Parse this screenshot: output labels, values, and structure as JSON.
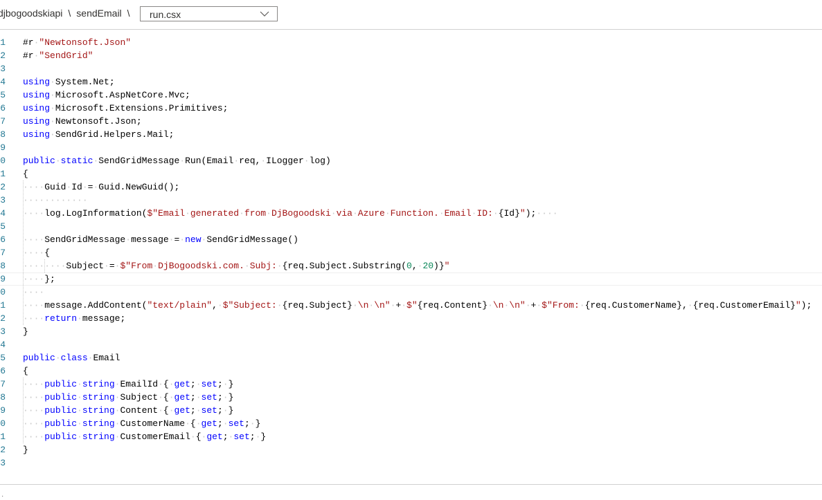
{
  "breadcrumb": {
    "items": [
      "djbogoodskiapi",
      "sendEmail"
    ],
    "separator": "\\"
  },
  "file_selector": {
    "value": "run.csx"
  },
  "editor": {
    "lines": [
      {
        "n": "1",
        "tokens": [
          [
            "p",
            "#r"
          ],
          [
            "w",
            "·"
          ],
          [
            "s",
            "\"Newtonsoft.Json\""
          ]
        ]
      },
      {
        "n": "2",
        "tokens": [
          [
            "p",
            "#r"
          ],
          [
            "w",
            "·"
          ],
          [
            "s",
            "\"SendGrid\""
          ]
        ]
      },
      {
        "n": "3",
        "tokens": []
      },
      {
        "n": "4",
        "tokens": [
          [
            "k",
            "using"
          ],
          [
            "w",
            "·"
          ],
          [
            "p",
            "System.Net;"
          ]
        ]
      },
      {
        "n": "5",
        "tokens": [
          [
            "k",
            "using"
          ],
          [
            "w",
            "·"
          ],
          [
            "p",
            "Microsoft.AspNetCore.Mvc;"
          ]
        ]
      },
      {
        "n": "6",
        "tokens": [
          [
            "k",
            "using"
          ],
          [
            "w",
            "·"
          ],
          [
            "p",
            "Microsoft.Extensions.Primitives;"
          ]
        ]
      },
      {
        "n": "7",
        "tokens": [
          [
            "k",
            "using"
          ],
          [
            "w",
            "·"
          ],
          [
            "p",
            "Newtonsoft.Json;"
          ]
        ]
      },
      {
        "n": "8",
        "tokens": [
          [
            "k",
            "using"
          ],
          [
            "w",
            "·"
          ],
          [
            "p",
            "SendGrid.Helpers.Mail;"
          ]
        ]
      },
      {
        "n": "9",
        "tokens": []
      },
      {
        "n": "0",
        "tokens": [
          [
            "k",
            "public"
          ],
          [
            "w",
            "·"
          ],
          [
            "k",
            "static"
          ],
          [
            "w",
            "·"
          ],
          [
            "p",
            "SendGridMessage"
          ],
          [
            "w",
            "·"
          ],
          [
            "p",
            "Run(Email"
          ],
          [
            "w",
            "·"
          ],
          [
            "p",
            "req,"
          ],
          [
            "w",
            "·"
          ],
          [
            "p",
            "ILogger"
          ],
          [
            "w",
            "·"
          ],
          [
            "p",
            "log)"
          ]
        ]
      },
      {
        "n": "1",
        "tokens": [
          [
            "p",
            "{"
          ]
        ]
      },
      {
        "n": "2",
        "tokens": [
          [
            "w",
            "····"
          ],
          [
            "p",
            "Guid"
          ],
          [
            "w",
            "·"
          ],
          [
            "p",
            "Id"
          ],
          [
            "w",
            "·"
          ],
          [
            "p",
            "="
          ],
          [
            "w",
            "·"
          ],
          [
            "p",
            "Guid.NewGuid();"
          ]
        ]
      },
      {
        "n": "3",
        "tokens": [
          [
            "w",
            "············"
          ]
        ]
      },
      {
        "n": "4",
        "tokens": [
          [
            "w",
            "····"
          ],
          [
            "p",
            "log.LogInformation("
          ],
          [
            "s",
            "$\"Email"
          ],
          [
            "w",
            "·"
          ],
          [
            "s",
            "generated"
          ],
          [
            "w",
            "·"
          ],
          [
            "s",
            "from"
          ],
          [
            "w",
            "·"
          ],
          [
            "s",
            "DjBogoodski"
          ],
          [
            "w",
            "·"
          ],
          [
            "s",
            "via"
          ],
          [
            "w",
            "·"
          ],
          [
            "s",
            "Azure"
          ],
          [
            "w",
            "·"
          ],
          [
            "s",
            "Function."
          ],
          [
            "w",
            "·"
          ],
          [
            "s",
            "Email"
          ],
          [
            "w",
            "·"
          ],
          [
            "s",
            "ID:"
          ],
          [
            "w",
            "·"
          ],
          [
            "p",
            "{Id}"
          ],
          [
            "s",
            "\""
          ],
          [
            "p",
            ");"
          ],
          [
            "w",
            "····"
          ]
        ]
      },
      {
        "n": "5",
        "tokens": []
      },
      {
        "n": "6",
        "tokens": [
          [
            "w",
            "····"
          ],
          [
            "p",
            "SendGridMessage"
          ],
          [
            "w",
            "·"
          ],
          [
            "p",
            "message"
          ],
          [
            "w",
            "·"
          ],
          [
            "p",
            "="
          ],
          [
            "w",
            "·"
          ],
          [
            "k",
            "new"
          ],
          [
            "w",
            "·"
          ],
          [
            "p",
            "SendGridMessage()"
          ]
        ]
      },
      {
        "n": "7",
        "tokens": [
          [
            "w",
            "····"
          ],
          [
            "p",
            "{"
          ]
        ]
      },
      {
        "n": "8",
        "tokens": [
          [
            "w",
            "········"
          ],
          [
            "p",
            "Subject"
          ],
          [
            "w",
            "·"
          ],
          [
            "p",
            "="
          ],
          [
            "w",
            "·"
          ],
          [
            "s",
            "$\"From"
          ],
          [
            "w",
            "·"
          ],
          [
            "s",
            "DjBogoodski.com."
          ],
          [
            "w",
            "·"
          ],
          [
            "s",
            "Subj:"
          ],
          [
            "w",
            "·"
          ],
          [
            "p",
            "{req.Subject.Substring("
          ],
          [
            "n",
            "0"
          ],
          [
            "p",
            ","
          ],
          [
            "w",
            "·"
          ],
          [
            "n",
            "20"
          ],
          [
            "p",
            ")}"
          ],
          [
            "s",
            "\""
          ]
        ]
      },
      {
        "n": "9",
        "cur": true,
        "tokens": [
          [
            "w",
            "····"
          ],
          [
            "p",
            "};"
          ]
        ]
      },
      {
        "n": "0",
        "tokens": [
          [
            "w",
            "····"
          ]
        ]
      },
      {
        "n": "1",
        "tokens": [
          [
            "w",
            "····"
          ],
          [
            "p",
            "message.AddContent("
          ],
          [
            "s",
            "\"text/plain\""
          ],
          [
            "p",
            ","
          ],
          [
            "w",
            "·"
          ],
          [
            "s",
            "$\"Subject:"
          ],
          [
            "w",
            "·"
          ],
          [
            "p",
            "{req.Subject}"
          ],
          [
            "w",
            "·"
          ],
          [
            "s",
            "\\n"
          ],
          [
            "w",
            "·"
          ],
          [
            "s",
            "\\n\""
          ],
          [
            "w",
            "·"
          ],
          [
            "p",
            "+"
          ],
          [
            "w",
            "·"
          ],
          [
            "s",
            "$\""
          ],
          [
            "p",
            "{req.Content}"
          ],
          [
            "w",
            "·"
          ],
          [
            "s",
            "\\n"
          ],
          [
            "w",
            "·"
          ],
          [
            "s",
            "\\n\""
          ],
          [
            "w",
            "·"
          ],
          [
            "p",
            "+"
          ],
          [
            "w",
            "·"
          ],
          [
            "s",
            "$\"From:"
          ],
          [
            "w",
            "·"
          ],
          [
            "p",
            "{req.CustomerName},"
          ],
          [
            "w",
            "·"
          ],
          [
            "p",
            "{req.CustomerEmail}"
          ],
          [
            "s",
            "\""
          ],
          [
            "p",
            ");"
          ]
        ]
      },
      {
        "n": "2",
        "tokens": [
          [
            "w",
            "····"
          ],
          [
            "k",
            "return"
          ],
          [
            "w",
            "·"
          ],
          [
            "p",
            "message;"
          ]
        ]
      },
      {
        "n": "3",
        "tokens": [
          [
            "p",
            "}"
          ]
        ]
      },
      {
        "n": "4",
        "tokens": []
      },
      {
        "n": "5",
        "tokens": [
          [
            "k",
            "public"
          ],
          [
            "w",
            "·"
          ],
          [
            "k",
            "class"
          ],
          [
            "w",
            "·"
          ],
          [
            "p",
            "Email"
          ]
        ]
      },
      {
        "n": "6",
        "tokens": [
          [
            "p",
            "{"
          ]
        ]
      },
      {
        "n": "7",
        "tokens": [
          [
            "w",
            "····"
          ],
          [
            "k",
            "public"
          ],
          [
            "w",
            "·"
          ],
          [
            "k",
            "string"
          ],
          [
            "w",
            "·"
          ],
          [
            "p",
            "EmailId"
          ],
          [
            "w",
            "·"
          ],
          [
            "p",
            "{"
          ],
          [
            "w",
            "·"
          ],
          [
            "k",
            "get"
          ],
          [
            "p",
            ";"
          ],
          [
            "w",
            "·"
          ],
          [
            "k",
            "set"
          ],
          [
            "p",
            ";"
          ],
          [
            "w",
            "·"
          ],
          [
            "p",
            "}"
          ]
        ]
      },
      {
        "n": "8",
        "tokens": [
          [
            "w",
            "····"
          ],
          [
            "k",
            "public"
          ],
          [
            "w",
            "·"
          ],
          [
            "k",
            "string"
          ],
          [
            "w",
            "·"
          ],
          [
            "p",
            "Subject"
          ],
          [
            "w",
            "·"
          ],
          [
            "p",
            "{"
          ],
          [
            "w",
            "·"
          ],
          [
            "k",
            "get"
          ],
          [
            "p",
            ";"
          ],
          [
            "w",
            "·"
          ],
          [
            "k",
            "set"
          ],
          [
            "p",
            ";"
          ],
          [
            "w",
            "·"
          ],
          [
            "p",
            "}"
          ]
        ]
      },
      {
        "n": "9",
        "tokens": [
          [
            "w",
            "····"
          ],
          [
            "k",
            "public"
          ],
          [
            "w",
            "·"
          ],
          [
            "k",
            "string"
          ],
          [
            "w",
            "·"
          ],
          [
            "p",
            "Content"
          ],
          [
            "w",
            "·"
          ],
          [
            "p",
            "{"
          ],
          [
            "w",
            "·"
          ],
          [
            "k",
            "get"
          ],
          [
            "p",
            ";"
          ],
          [
            "w",
            "·"
          ],
          [
            "k",
            "set"
          ],
          [
            "p",
            ";"
          ],
          [
            "w",
            "·"
          ],
          [
            "p",
            "}"
          ]
        ]
      },
      {
        "n": "0",
        "tokens": [
          [
            "w",
            "····"
          ],
          [
            "k",
            "public"
          ],
          [
            "w",
            "·"
          ],
          [
            "k",
            "string"
          ],
          [
            "w",
            "·"
          ],
          [
            "p",
            "CustomerName"
          ],
          [
            "w",
            "·"
          ],
          [
            "p",
            "{"
          ],
          [
            "w",
            "·"
          ],
          [
            "k",
            "get"
          ],
          [
            "p",
            ";"
          ],
          [
            "w",
            "·"
          ],
          [
            "k",
            "set"
          ],
          [
            "p",
            ";"
          ],
          [
            "w",
            "·"
          ],
          [
            "p",
            "}"
          ]
        ]
      },
      {
        "n": "1",
        "tokens": [
          [
            "w",
            "····"
          ],
          [
            "k",
            "public"
          ],
          [
            "w",
            "·"
          ],
          [
            "k",
            "string"
          ],
          [
            "w",
            "·"
          ],
          [
            "p",
            "CustomerEmail"
          ],
          [
            "w",
            "·"
          ],
          [
            "p",
            "{"
          ],
          [
            "w",
            "·"
          ],
          [
            "k",
            "get"
          ],
          [
            "p",
            ";"
          ],
          [
            "w",
            "·"
          ],
          [
            "k",
            "set"
          ],
          [
            "p",
            ";"
          ],
          [
            "w",
            "·"
          ],
          [
            "p",
            "}"
          ]
        ]
      },
      {
        "n": "2",
        "tokens": [
          [
            "p",
            "}"
          ]
        ]
      },
      {
        "n": "3",
        "tokens": []
      }
    ]
  },
  "colors": {
    "keyword": "#0000ff",
    "string": "#a31515",
    "number": "#098658",
    "whitespace": "#c8c8c8",
    "line_number": "#237893"
  },
  "icons": {
    "file_selector_chevron": "chevron-down-icon"
  }
}
